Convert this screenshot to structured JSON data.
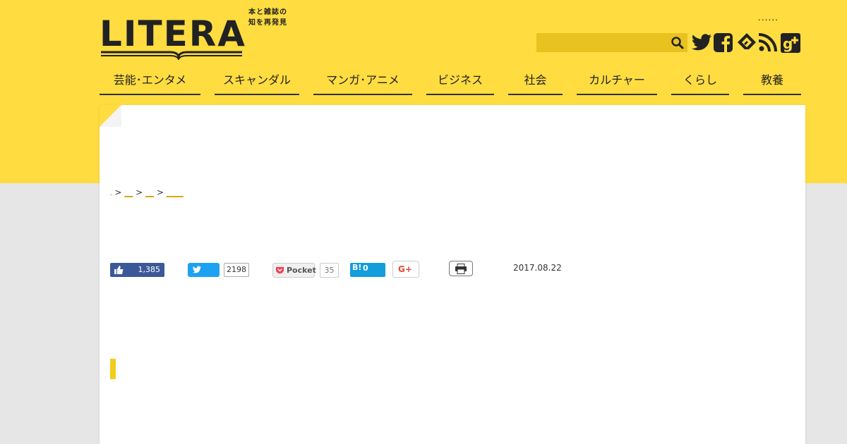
{
  "header": {
    "logo_text": "LITERA",
    "tagline_line1": "本と雑誌の",
    "tagline_line2": "知を再発見",
    "top_link": "......"
  },
  "search": {
    "placeholder": ""
  },
  "nav": {
    "items": [
      {
        "label": "芸能･エンタメ"
      },
      {
        "label": "スキャンダル"
      },
      {
        "label": "マンガ･アニメ"
      },
      {
        "label": "ビジネス"
      },
      {
        "label": "社会"
      },
      {
        "label": "カルチャー"
      },
      {
        "label": "くらし"
      },
      {
        "label": "教養"
      }
    ]
  },
  "breadcrumb": {
    "home": ".",
    "sep": ">",
    "links": [
      "__",
      "__",
      "____"
    ]
  },
  "share": {
    "facebook_count": "1,385",
    "twitter_count": "2198",
    "pocket_label": "Pocket",
    "pocket_count": "35",
    "hatena_label": "B!",
    "hatena_count": "0",
    "gplus_label": "G+"
  },
  "article": {
    "date": "2017.08.22"
  },
  "colors": {
    "brand_yellow": "#ffdc40",
    "search_bg": "#e8c31f",
    "facebook": "#3b5998",
    "twitter": "#1da1f2",
    "hatena": "#139edb",
    "link": "#d4a500"
  },
  "icons": [
    "search-icon",
    "twitter-icon",
    "facebook-icon",
    "feedly-icon",
    "rss-icon",
    "google-plus-icon",
    "thumbs-up-icon",
    "pocket-icon",
    "print-icon"
  ]
}
